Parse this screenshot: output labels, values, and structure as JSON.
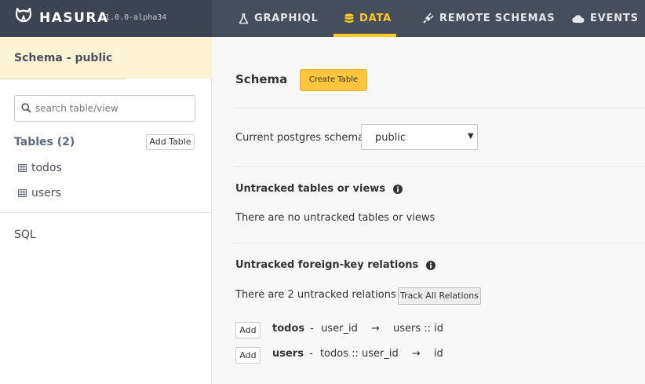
{
  "header": {
    "brand": "HASURA",
    "version": "v1.0.0-alpha34",
    "nav": [
      {
        "label": "GRAPHIQL",
        "icon": "flask-icon",
        "active": false
      },
      {
        "label": "DATA",
        "icon": "database-icon",
        "active": true
      },
      {
        "label": "REMOTE SCHEMAS",
        "icon": "plug-icon",
        "active": false
      },
      {
        "label": "EVENTS",
        "icon": "cloud-icon",
        "active": false
      }
    ],
    "accent_color": "#ffca27"
  },
  "sidebar": {
    "schema_title": "Schema - public",
    "search_placeholder": "search table/view",
    "tables_heading": "Tables (2)",
    "add_table_label": "Add Table",
    "tables": [
      "todos",
      "users"
    ],
    "sql_label": "SQL"
  },
  "main": {
    "title": "Schema",
    "create_table_label": "Create Table",
    "schema_label": "Current postgres schema",
    "schema_value": "public",
    "untracked_tables_title": "Untracked tables or views",
    "untracked_tables_text": "There are no untracked tables or views",
    "untracked_relations_title": "Untracked foreign-key relations",
    "untracked_relations_text": "There are 2 untracked relations",
    "track_all_label": "Track All Relations",
    "add_label": "Add",
    "relations": [
      {
        "table": "todos",
        "sep": "-",
        "from": "user_id",
        "arrow": "→",
        "to": "users :: id"
      },
      {
        "table": "users",
        "sep": "-",
        "from": "todos :: user_id",
        "arrow": "→",
        "to": "id"
      }
    ]
  }
}
